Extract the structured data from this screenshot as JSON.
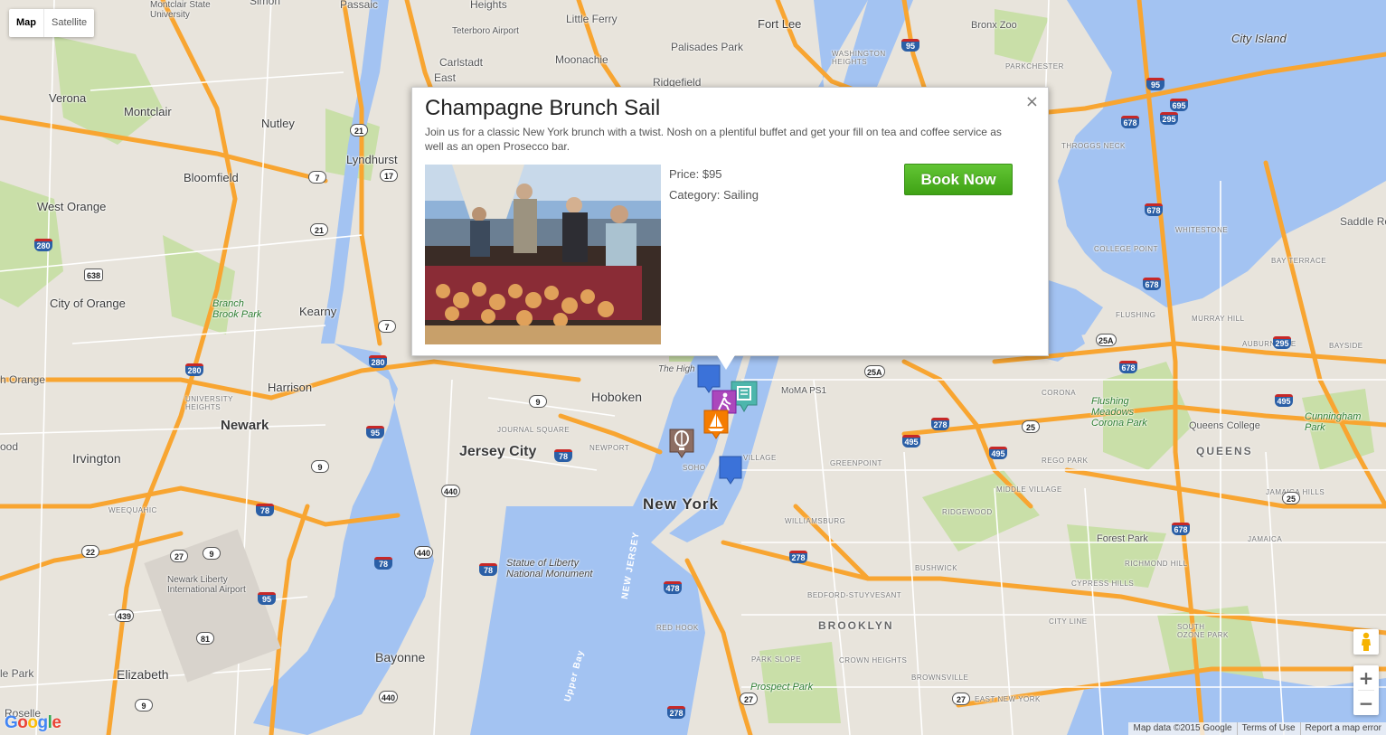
{
  "map_type": {
    "map": "Map",
    "satellite": "Satellite"
  },
  "info": {
    "title": "Champagne Brunch Sail",
    "description": "Join us for a classic New York brunch with a twist. Nosh on a plentiful buffet and get your fill on tea and coffee service as well as an open Prosecco bar.",
    "price": "Price: $95",
    "category": "Category: Sailing",
    "book": "Book Now",
    "close": "×"
  },
  "controls": {
    "zoom_in": "+",
    "zoom_out": "−"
  },
  "footer": {
    "data": "Map data ©2015 Google",
    "terms": "Terms of Use",
    "report": "Report a map error"
  },
  "logo": "Google",
  "labels": {
    "new_york": "New York",
    "jersey_city": "Jersey City",
    "newark": "Newark",
    "hoboken": "Hoboken",
    "brooklyn": "BROOKLYN",
    "queens": "QUEENS",
    "elizabeth": "Elizabeth",
    "bayonne": "Bayonne",
    "irvington": "Irvington",
    "harrison": "Harrison",
    "kearny": "Kearny",
    "city_of_orange": "City of Orange",
    "west_orange": "West Orange",
    "bloomfield": "Bloomfield",
    "montclair": "Montclair",
    "nutley": "Nutley",
    "lyndhurst": "Lyndhurst",
    "verona": "Verona",
    "fort_lee": "Fort Lee",
    "ridgefield": "Ridgefield",
    "moonachie": "Moonachie",
    "palisades_park": "Palisades Park",
    "little_ferry": "Little Ferry",
    "carlstadt": "Carlstadt",
    "east_rutherford": "East",
    "bronx_zoo": "Bronx Zoo",
    "city_island": "City Island",
    "saddle_rock": "Saddle Roc",
    "forest_park": "Forest Park",
    "queens_college": "Queens College",
    "flushing_meadows": "Flushing Meadows Corona Park",
    "cunningham_park": "Cunningham Park",
    "prospect_park": "Prospect Park",
    "branch_brook": "Branch Brook Park",
    "statue_liberty": "Statue of Liberty National Monument",
    "newark_airport": "Newark Liberty International Airport",
    "teterboro": "Teterboro Airport",
    "moma": "MoMA PS1",
    "rosell": "Roselle",
    "orange": "h Orange",
    "hood": "ood",
    "le_park": "le Park",
    "upper_bay": "Upper Bay",
    "new_jersey": "NEW JERSEY",
    "high_line": "The High",
    "heights": "Heights",
    "simon": "Simon",
    "passaic": "Passaic",
    "upper_montclair": "Montclair State University",
    "whitestone": "WHITESTONE",
    "college_point": "COLLEGE POINT",
    "flushing": "FLUSHING",
    "murray_hill": "MURRAY HILL",
    "bayside": "BAYSIDE",
    "corona": "CORONA",
    "rego_park": "REGO PARK",
    "middle_village": "MIDDLE VILLAGE",
    "ridgewood": "RIDGEWOOD",
    "greenpoint": "GREENPOINT",
    "williamsburg": "WILLIAMSBURG",
    "bushwick": "BUSHWICK",
    "bed_stuy": "BEDFORD-STUYVESANT",
    "east_ny": "EAST NEW YORK",
    "brownsville": "BROWNSVILLE",
    "crown_heights": "CROWN HEIGHTS",
    "park_slope": "PARK SLOPE",
    "red_hook": "RED HOOK",
    "cypress_hills": "CYPRESS HILLS",
    "richmond_hill": "RICHMOND HILL",
    "jamaica": "JAMAICA",
    "south_ozone": "SOUTH OZONE PARK",
    "city_line": "CITY LINE",
    "east_flatbush": "EAST FLATBUSH",
    "jamaica_hills": "JAMAICA HILLS",
    "auburndale": "AUBURNDALE",
    "bay_terrace": "BAY TERRACE",
    "douglaston": "DOUGLASTON",
    "parkchester": "PARKCHESTER",
    "throggs_neck": "THROGGS NECK",
    "journal_square": "JOURNAL SQUARE",
    "newport": "NEWPORT",
    "soho": "SOHO",
    "village": "VILLAGE",
    "weequahic": "WEEQUAHIC",
    "university_heights": "UNIVERSITY HEIGHTS",
    "washington_heights": "WASHINGTON HEIGHTS"
  },
  "markers": [
    {
      "name": "sailing-marker",
      "color": "#f57c00",
      "icon": "sailboat"
    },
    {
      "name": "hiking-marker",
      "color": "#ab47bc",
      "icon": "hiker"
    },
    {
      "name": "balloon-marker",
      "color": "#8d6e63",
      "icon": "balloon"
    },
    {
      "name": "blue-marker-1",
      "color": "#3b72d9",
      "icon": "pin"
    },
    {
      "name": "blue-marker-2",
      "color": "#3b72d9",
      "icon": "pin"
    },
    {
      "name": "teal-marker",
      "color": "#4db6ac",
      "icon": "ticket"
    }
  ]
}
